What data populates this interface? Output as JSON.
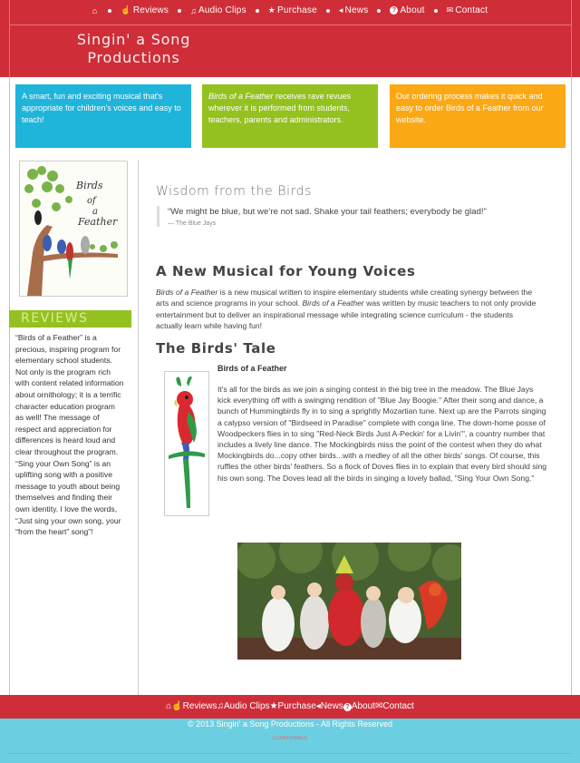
{
  "nav": {
    "items": [
      {
        "label": "",
        "icon": "home-icon"
      },
      {
        "label": "Reviews",
        "icon": "thumbs-up-icon"
      },
      {
        "label": "Audio Clips",
        "icon": "music-note-icon"
      },
      {
        "label": "Purchase",
        "icon": "star-icon"
      },
      {
        "label": "News",
        "icon": "megaphone-icon"
      },
      {
        "label": "About",
        "icon": "question-circle-icon"
      },
      {
        "label": "Contact",
        "icon": "envelope-icon"
      }
    ]
  },
  "site": {
    "title_line1": "Singin' a Song",
    "title_line2": "Productions"
  },
  "features": {
    "box1": "A smart, fun and exciting musical that's appropriate for children's voices and easy to teach!",
    "box2_italic": "Birds of a Feather",
    "box2_rest": " receives rave revues wherever it is performed from students, teachers, parents and administrators.",
    "box3": "Our ordering process makes it quick and easy to order Birds of a Feather from our website."
  },
  "sidebar": {
    "book_cover_text": "Birds of a Feather",
    "reviews_heading": "REVIEWS",
    "review_text": "“Birds of a Feather” is a precious, inspiring program for elementary school students. Not only is the program rich with content related information about ornithology;  it is a terrific character education program as well! The message of respect and appreciation for differences is heard loud and clear throughout the program. “Sing your Own Song” is an uplifting song with a positive message to youth about being themselves and finding their own identity. I love the words, “Just sing your own song, your “from the heart” song”!"
  },
  "main": {
    "wisdom_heading": "Wisdom from the Birds",
    "quote": "“We might be blue, but we’re not sad. Shake your tail feathers; everybody be glad!”",
    "quote_cite": "— The Blue Jays",
    "musical_heading": "A New Musical for Young Voices",
    "musical_p1_italic": "Birds of a Feather",
    "musical_p1_a": " is a new musical written to inspire elementary students while creating synergy between the arts and science programs in your school.  ",
    "musical_p1_italic2": "Birds of a Feather",
    "musical_p1_b": " was written by music teachers to not only provide entertainment but to deliver an inspirational message while integrating science curriculum - the students actually learn while having fun!",
    "tale_heading": "The Birds' Tale",
    "tale_subheading": "Birds of a Feather",
    "tale_text": "It's all for the birds as we join a singing contest in the big tree in the meadow.  The Blue Jays kick everything off with a swinging rendition of \"Blue Jay Boogie.\"  After their song and dance, a bunch of Hummingbirds fly in to sing a sprightly Mozartian tune.  Next up are the Parrots singing a calypso version of \"Birdseed in Paradise\" complete with conga line.  The down-home posse of Woodpeckers flies in to sing \"Red-Neck Birds Just A-Peckin' for a Livin'\", a country number that includes a lively line dance.  The Mockingbirds miss the point of the contest when they do what Mockingbirds do...copy other birds...with a medley of all the other birds' songs.  Of course, this ruffles the other birds' feathers.  So a flock of Doves flies in to explain that every bird should sing his own song.  The Doves lead all the birds in singing a lovely ballad, \"Sing Your Own Song.\""
  },
  "footer": {
    "copyright": "© 2013 Singin' a Song Productions - All Rights Reserved",
    "powered": "CLICKFUNNELS"
  },
  "colors": {
    "brand_red": "#cf2e38",
    "blue": "#1fb4da",
    "green": "#94c11f",
    "orange": "#fba815",
    "footer_blue": "#6ccfe1"
  }
}
